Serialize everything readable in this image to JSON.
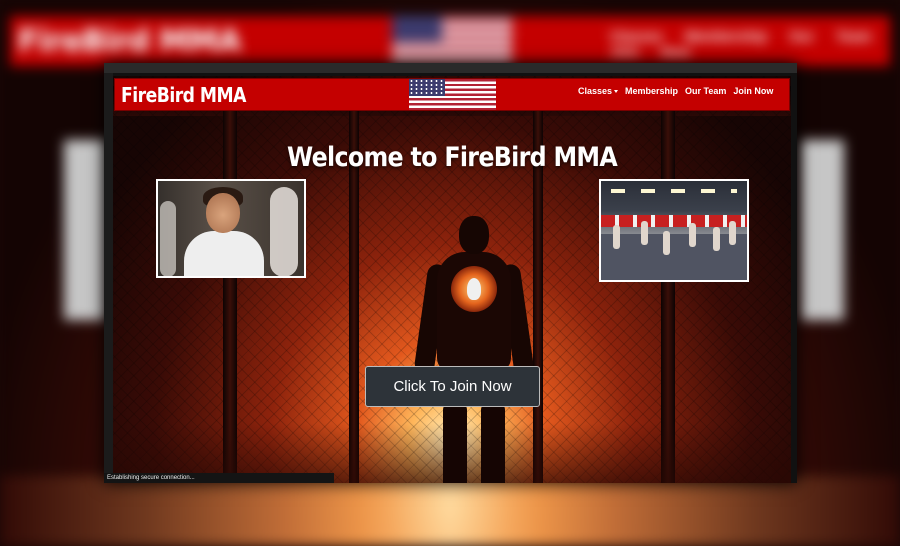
{
  "site": {
    "brand": "FireBird MMA",
    "nav": [
      {
        "label": "Classes",
        "has_dropdown": true
      },
      {
        "label": "Membership",
        "has_dropdown": false
      },
      {
        "label": "Our Team",
        "has_dropdown": false
      },
      {
        "label": "Join Now",
        "has_dropdown": false
      }
    ]
  },
  "hero": {
    "heading": "Welcome to FireBird MMA",
    "cta_label": "Click To Join Now"
  },
  "browser": {
    "status": "Establishing secure connection..."
  },
  "colors": {
    "navbar": "#c40000",
    "cta_bg": "#2d3339",
    "text": "#ffffff"
  },
  "icons": [
    "us-flag-icon",
    "chevron-down-icon"
  ]
}
